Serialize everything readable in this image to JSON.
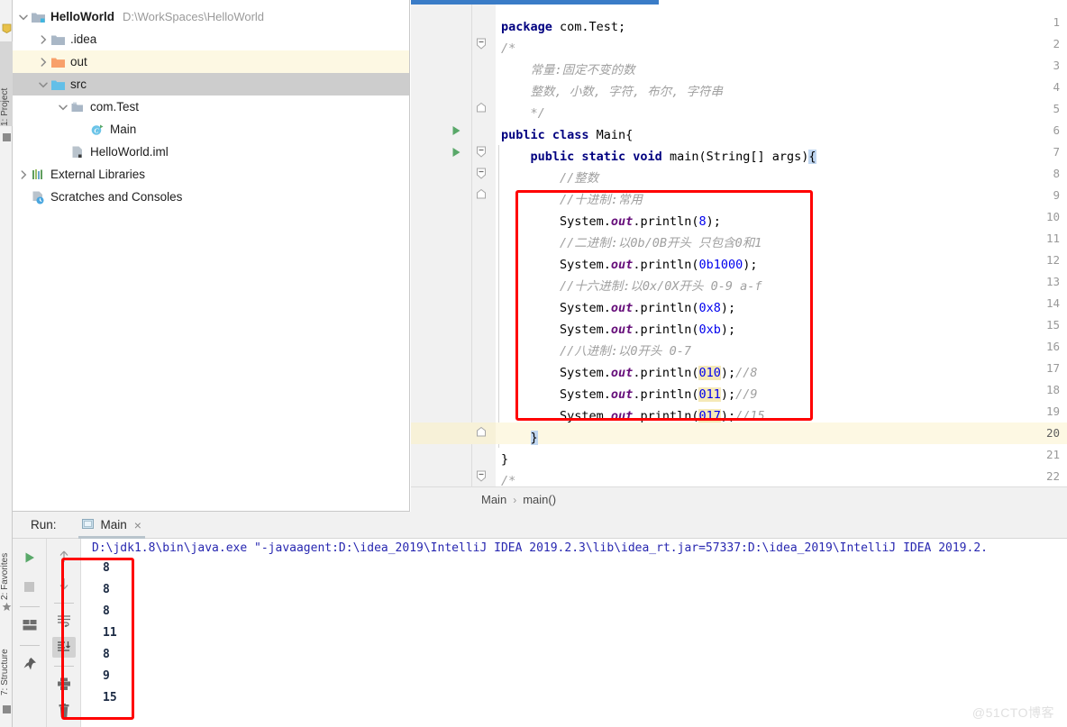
{
  "left_strip": {
    "tabs": [
      {
        "name": "project",
        "label": "1: Project",
        "selected": true
      },
      {
        "name": "favorites",
        "label": "2: Favorites",
        "selected": false
      },
      {
        "name": "structure",
        "label": "7: Structure",
        "selected": false
      }
    ],
    "icons": [
      "bookmark-icon",
      "star-icon",
      "structure-icon"
    ]
  },
  "project_tree": {
    "items": [
      {
        "depth": 0,
        "arrow": "chevron-down",
        "icon": "module-folder-icon",
        "label": "HelloWorld",
        "bold": true,
        "path": "D:\\WorkSpaces\\HelloWorld",
        "highlight": "none"
      },
      {
        "depth": 1,
        "arrow": "chevron-right",
        "icon": "folder-gray-icon",
        "label": ".idea",
        "bold": false,
        "path": "",
        "highlight": "none"
      },
      {
        "depth": 1,
        "arrow": "chevron-right",
        "icon": "folder-orange-icon",
        "label": "out",
        "bold": false,
        "path": "",
        "highlight": "yellow"
      },
      {
        "depth": 1,
        "arrow": "chevron-down",
        "icon": "folder-blue-icon",
        "label": "src",
        "bold": false,
        "path": "",
        "highlight": "gray"
      },
      {
        "depth": 2,
        "arrow": "chevron-down",
        "icon": "package-icon",
        "label": "com.Test",
        "bold": false,
        "path": "",
        "highlight": "none"
      },
      {
        "depth": 3,
        "arrow": "none",
        "icon": "java-class-runnable-icon",
        "label": "Main",
        "bold": false,
        "path": "",
        "highlight": "none"
      },
      {
        "depth": 2,
        "arrow": "none",
        "icon": "iml-file-icon",
        "label": "HelloWorld.iml",
        "bold": false,
        "path": "",
        "highlight": "none"
      },
      {
        "depth": 0,
        "arrow": "chevron-right",
        "icon": "libraries-icon",
        "label": "External Libraries",
        "bold": false,
        "path": "",
        "highlight": "none"
      },
      {
        "depth": 0,
        "arrow": "none",
        "icon": "scratches-icon",
        "label": "Scratches and Consoles",
        "bold": false,
        "path": "",
        "highlight": "none"
      }
    ]
  },
  "editor": {
    "scrollbar_top": true,
    "lines": [
      {
        "no": "1",
        "run": false,
        "fold": "none",
        "indent": 0,
        "tokens": [
          {
            "t": "package ",
            "c": "kw"
          },
          {
            "t": "com.Test;",
            "c": ""
          }
        ]
      },
      {
        "no": "2",
        "run": false,
        "fold": "open-minus",
        "indent": 0,
        "tokens": [
          {
            "t": "/*",
            "c": "cmt"
          }
        ]
      },
      {
        "no": "3",
        "run": false,
        "fold": "none",
        "indent": 0,
        "tokens": [
          {
            "t": "    常量:固定不变的数",
            "c": "cmt"
          }
        ]
      },
      {
        "no": "4",
        "run": false,
        "fold": "none",
        "indent": 0,
        "tokens": [
          {
            "t": "    整数, 小数, 字符, 布尔, 字符串",
            "c": "cmt"
          }
        ]
      },
      {
        "no": "5",
        "run": false,
        "fold": "end",
        "indent": 0,
        "tokens": [
          {
            "t": "    */",
            "c": "cmt"
          }
        ]
      },
      {
        "no": "6",
        "run": true,
        "fold": "none",
        "indent": 0,
        "tokens": [
          {
            "t": "public class ",
            "c": "kw"
          },
          {
            "t": "Main{",
            "c": ""
          }
        ]
      },
      {
        "no": "7",
        "run": true,
        "fold": "open-minus",
        "indent": 1,
        "tokens": [
          {
            "t": "    ",
            "c": ""
          },
          {
            "t": "public static void ",
            "c": "kw"
          },
          {
            "t": "main(String[] args)",
            "c": ""
          },
          {
            "t": "{",
            "c": "cursor-hl"
          }
        ]
      },
      {
        "no": "8",
        "run": false,
        "fold": "open-minus",
        "indent": 1,
        "tokens": [
          {
            "t": "        //整数",
            "c": "cmt"
          }
        ]
      },
      {
        "no": "9",
        "run": false,
        "fold": "end",
        "indent": 1,
        "tokens": [
          {
            "t": "        //十进制:常用",
            "c": "cmt"
          }
        ]
      },
      {
        "no": "10",
        "run": false,
        "fold": "none",
        "indent": 1,
        "tokens": [
          {
            "t": "        System.",
            "c": ""
          },
          {
            "t": "out",
            "c": "fld"
          },
          {
            "t": ".println(",
            "c": ""
          },
          {
            "t": "8",
            "c": "num"
          },
          {
            "t": ");",
            "c": ""
          }
        ]
      },
      {
        "no": "11",
        "run": false,
        "fold": "none",
        "indent": 1,
        "tokens": [
          {
            "t": "        //二进制:以0b/0B开头 只包含0和1",
            "c": "cmt"
          }
        ]
      },
      {
        "no": "12",
        "run": false,
        "fold": "none",
        "indent": 1,
        "tokens": [
          {
            "t": "        System.",
            "c": ""
          },
          {
            "t": "out",
            "c": "fld"
          },
          {
            "t": ".println(",
            "c": ""
          },
          {
            "t": "0b1000",
            "c": "num"
          },
          {
            "t": ");",
            "c": ""
          }
        ]
      },
      {
        "no": "13",
        "run": false,
        "fold": "none",
        "indent": 1,
        "tokens": [
          {
            "t": "        //十六进制:以0x/0X开头 0-9 a-f",
            "c": "cmt"
          }
        ]
      },
      {
        "no": "14",
        "run": false,
        "fold": "none",
        "indent": 1,
        "tokens": [
          {
            "t": "        System.",
            "c": ""
          },
          {
            "t": "out",
            "c": "fld"
          },
          {
            "t": ".println(",
            "c": ""
          },
          {
            "t": "0x8",
            "c": "num"
          },
          {
            "t": ");",
            "c": ""
          }
        ]
      },
      {
        "no": "15",
        "run": false,
        "fold": "none",
        "indent": 1,
        "tokens": [
          {
            "t": "        System.",
            "c": ""
          },
          {
            "t": "out",
            "c": "fld"
          },
          {
            "t": ".println(",
            "c": ""
          },
          {
            "t": "0xb",
            "c": "num"
          },
          {
            "t": ");",
            "c": ""
          }
        ]
      },
      {
        "no": "16",
        "run": false,
        "fold": "none",
        "indent": 1,
        "tokens": [
          {
            "t": "        //八进制:以0开头 0-7",
            "c": "cmt"
          }
        ]
      },
      {
        "no": "17",
        "run": false,
        "fold": "none",
        "indent": 1,
        "tokens": [
          {
            "t": "        System.",
            "c": ""
          },
          {
            "t": "out",
            "c": "fld"
          },
          {
            "t": ".println(",
            "c": ""
          },
          {
            "t": "010",
            "c": "num num-hl"
          },
          {
            "t": ");",
            "c": ""
          },
          {
            "t": "//8",
            "c": "cmt"
          }
        ]
      },
      {
        "no": "18",
        "run": false,
        "fold": "none",
        "indent": 1,
        "tokens": [
          {
            "t": "        System.",
            "c": ""
          },
          {
            "t": "out",
            "c": "fld"
          },
          {
            "t": ".println(",
            "c": ""
          },
          {
            "t": "011",
            "c": "num num-hl"
          },
          {
            "t": ");",
            "c": ""
          },
          {
            "t": "//9",
            "c": "cmt"
          }
        ]
      },
      {
        "no": "19",
        "run": false,
        "fold": "none",
        "indent": 1,
        "tokens": [
          {
            "t": "        System.",
            "c": ""
          },
          {
            "t": "out",
            "c": "fld"
          },
          {
            "t": ".println(",
            "c": ""
          },
          {
            "t": "017",
            "c": "num num-hl"
          },
          {
            "t": ");",
            "c": ""
          },
          {
            "t": "//15",
            "c": "cmt"
          }
        ]
      },
      {
        "no": "20",
        "run": false,
        "fold": "end",
        "indent": 1,
        "current": true,
        "tokens": [
          {
            "t": "    ",
            "c": ""
          },
          {
            "t": "}",
            "c": "cursor-hl"
          }
        ]
      },
      {
        "no": "21",
        "run": false,
        "fold": "none",
        "indent": 0,
        "tokens": [
          {
            "t": "}",
            "c": ""
          }
        ]
      },
      {
        "no": "22",
        "run": false,
        "fold": "open-minus",
        "indent": 0,
        "tokens": [
          {
            "t": "/*",
            "c": "cmt"
          }
        ]
      }
    ],
    "breadcrumb": [
      "Main",
      "main()"
    ],
    "breadcrumb_separator": "›"
  },
  "annotations": {
    "editor_box": {
      "name": "editor-red-highlight-box"
    },
    "console_box": {
      "name": "console-red-highlight-box"
    }
  },
  "run_window": {
    "label": "Run:",
    "tab": {
      "name": "Main",
      "close": "×",
      "icon": "run-config-icon"
    },
    "toolbar_left": [
      {
        "name": "rerun-button",
        "icon": "play-icon"
      },
      {
        "name": "stop-button",
        "icon": "stop-icon"
      },
      {
        "name": "layout-button",
        "icon": "layout-icon"
      },
      {
        "name": "pin-button",
        "icon": "pin-icon"
      }
    ],
    "toolbar_right": [
      {
        "name": "prev-occurrence-button",
        "icon": "arrow-up-icon"
      },
      {
        "name": "next-occurrence-button",
        "icon": "arrow-down-icon"
      },
      {
        "name": "soft-wrap-button",
        "icon": "soft-wrap-icon"
      },
      {
        "name": "scroll-to-end-button",
        "icon": "scroll-end-icon",
        "active": true
      },
      {
        "name": "print-button",
        "icon": "printer-icon"
      },
      {
        "name": "clear-all-button",
        "icon": "trash-icon"
      }
    ],
    "console": {
      "command": "D:\\jdk1.8\\bin\\java.exe \"-javaagent:D:\\idea_2019\\IntelliJ IDEA 2019.2.3\\lib\\idea_rt.jar=57337:D:\\idea_2019\\IntelliJ IDEA 2019.2.",
      "output": [
        "8",
        "8",
        "8",
        "11",
        "8",
        "9",
        "15"
      ]
    }
  },
  "watermark": "@51CTO博客",
  "colors": {
    "accent_blue": "#3a7cc7",
    "keyword": "#000080",
    "comment": "#a0a0a0",
    "number": "#0000ee",
    "field": "#660e7a",
    "annotation_red": "#ff0000",
    "console_text": "#2727b0"
  }
}
